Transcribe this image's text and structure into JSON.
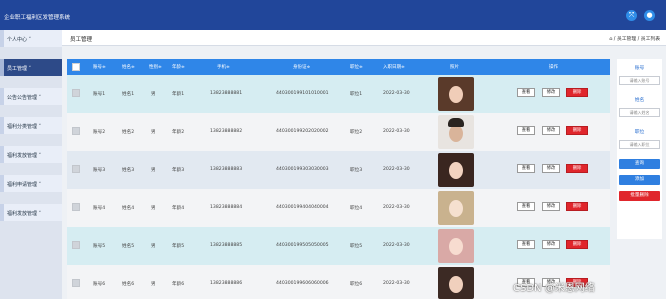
{
  "app": {
    "title": "企业职工福利区发管理系统"
  },
  "sidebar": {
    "items": [
      {
        "label": "个人中心 ˅"
      },
      {
        "label": "员工管理 ˅"
      },
      {
        "label": "公告公告管理 ˅"
      },
      {
        "label": "福利分类管理 ˅"
      },
      {
        "label": "福利发放管理 ˅"
      },
      {
        "label": "福利申请管理 ˅"
      },
      {
        "label": "福利发放管理 ˅"
      }
    ]
  },
  "header": {
    "title": "员工管理",
    "breadcrumb": "⌂ / 员工管理 / 员工列表"
  },
  "table": {
    "columns": [
      "账号≑",
      "姓名≑",
      "性别≑",
      "年龄≑",
      "手机≑",
      "身份证≑",
      "职位≑",
      "入职日期≑",
      "照片",
      "操作"
    ],
    "rows": [
      {
        "account": "账号1",
        "name": "姓名1",
        "gender": "男",
        "age": "年龄1",
        "phone": "13823888881",
        "id_card": "440300199101010001",
        "position": "职位1",
        "date": "2022-03-30"
      },
      {
        "account": "账号2",
        "name": "姓名2",
        "gender": "男",
        "age": "年龄2",
        "phone": "13823888882",
        "id_card": "440300199202020002",
        "position": "职位2",
        "date": "2022-03-30"
      },
      {
        "account": "账号3",
        "name": "姓名3",
        "gender": "男",
        "age": "年龄3",
        "phone": "13823888883",
        "id_card": "440300199303030003",
        "position": "职位3",
        "date": "2022-03-30"
      },
      {
        "account": "账号4",
        "name": "姓名4",
        "gender": "男",
        "age": "年龄4",
        "phone": "13823888884",
        "id_card": "440300199404040004",
        "position": "职位4",
        "date": "2022-03-30"
      },
      {
        "account": "账号5",
        "name": "姓名5",
        "gender": "男",
        "age": "年龄5",
        "phone": "13823888885",
        "id_card": "440300199505050005",
        "position": "职位5",
        "date": "2022-03-30"
      },
      {
        "account": "账号6",
        "name": "姓名6",
        "gender": "男",
        "age": "年龄6",
        "phone": "13823888886",
        "id_card": "440300199606060006",
        "position": "职位6",
        "date": "2022-03-30"
      }
    ],
    "actions": {
      "view": "查看",
      "edit": "修改",
      "delete": "删除"
    }
  },
  "search_panel": {
    "account_label": "账号",
    "account_placeholder": "请输入账号",
    "name_label": "姓名",
    "name_placeholder": "请输入姓名",
    "position_label": "职位",
    "position_placeholder": "请输入职位",
    "search_button": "查询",
    "add_button": "添加",
    "batch_delete_button": "批量删除"
  },
  "colors": {
    "topbar": "#21469a",
    "table_header": "#2f86e8",
    "delete": "#e0262c"
  },
  "watermark": "CSDN @米恩网络"
}
